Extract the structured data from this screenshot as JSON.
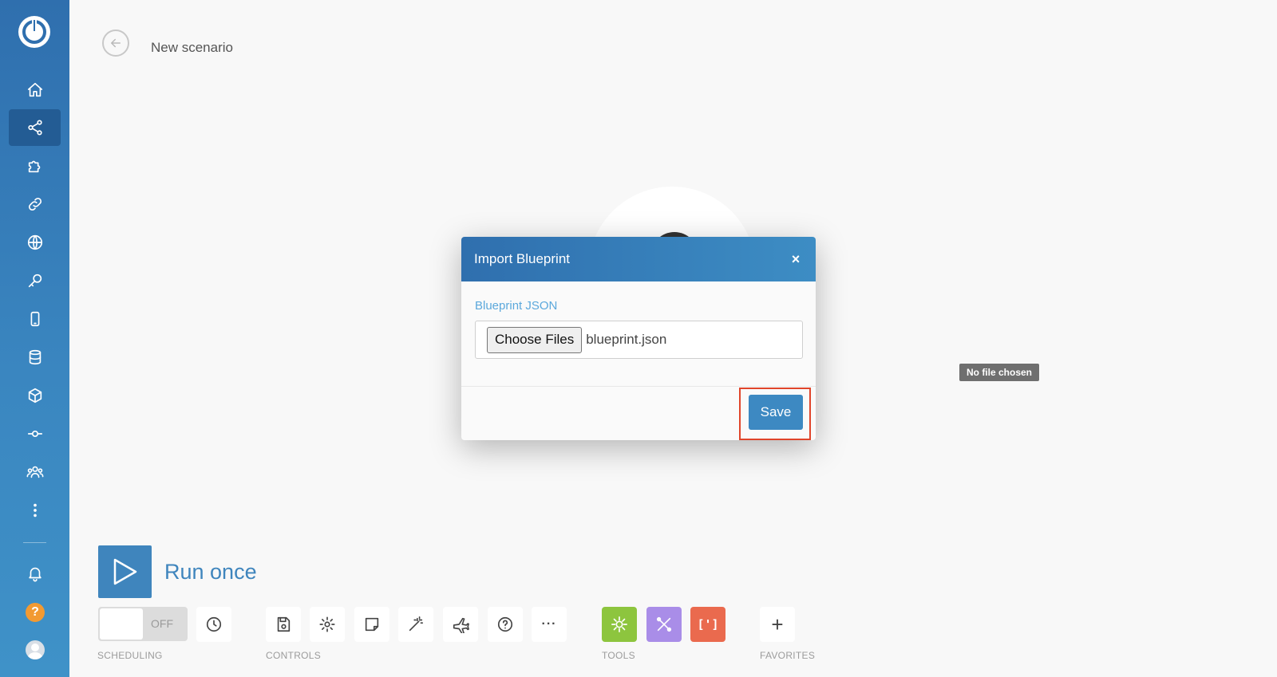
{
  "header": {
    "title": "New scenario"
  },
  "sidebar": {
    "items": [
      {
        "icon": "home-icon"
      },
      {
        "icon": "scenarios-icon",
        "active": true
      },
      {
        "icon": "puzzle-icon"
      },
      {
        "icon": "link-icon"
      },
      {
        "icon": "globe-icon"
      },
      {
        "icon": "key-icon"
      },
      {
        "icon": "device-icon"
      },
      {
        "icon": "database-icon"
      },
      {
        "icon": "box-icon"
      },
      {
        "icon": "flow-icon"
      },
      {
        "icon": "team-icon"
      },
      {
        "icon": "more-icon"
      }
    ],
    "help_label": "?"
  },
  "modal": {
    "title": "Import Blueprint",
    "close_label": "×",
    "field_label": "Blueprint JSON",
    "choose_label": "Choose Files",
    "file_name": "blueprint.json",
    "save_label": "Save"
  },
  "tooltip": {
    "text": "No file chosen"
  },
  "toolbar": {
    "run_label": "Run once",
    "toggle_label": "OFF",
    "scheduling_label": "SCHEDULING",
    "controls_label": "CONTROLS",
    "tools_label": "TOOLS",
    "favorites_label": "FAVORITES",
    "more_label": "···",
    "bracket_label": "[']",
    "add_label": "+"
  },
  "colors": {
    "accent": "#3f85bd",
    "sidebar": "#2f6fae",
    "highlight": "#e0452b",
    "tool_green": "#8dc53e",
    "tool_purple": "#a98de8",
    "tool_red": "#ea6a4e"
  }
}
